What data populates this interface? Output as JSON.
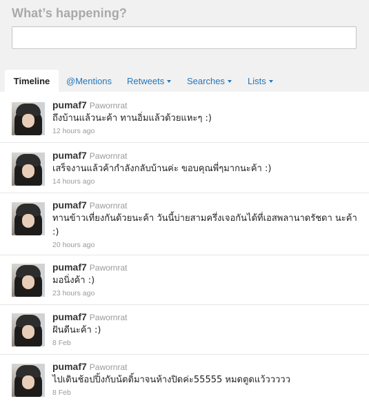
{
  "composer": {
    "heading": "What’s happening?",
    "placeholder": ""
  },
  "tabs": {
    "timeline": "Timeline",
    "mentions": "@Mentions",
    "retweets": "Retweets",
    "searches": "Searches",
    "lists": "Lists"
  },
  "tweets": [
    {
      "screen_name": "pumaf7",
      "full_name": "Pawornrat",
      "text": "ถึงบ้านแล้วนะค้า ทานอิ่มแล้วด้วยแหะๆ :)",
      "time": "12 hours ago"
    },
    {
      "screen_name": "pumaf7",
      "full_name": "Pawornrat",
      "text": "เสร็จงานแล้วค้ากำลังกลับบ้านค่ะ ขอบคุณพี่ๆมากนะค้า :)",
      "time": "14 hours ago"
    },
    {
      "screen_name": "pumaf7",
      "full_name": "Pawornrat",
      "text": "ทานข้าวเที่ยงกันด้วยนะค้า วันนี้บ่ายสามครึ่งเจอกันได้ที่เอสพลานาดรัชดา นะค้า :)",
      "time": "20 hours ago"
    },
    {
      "screen_name": "pumaf7",
      "full_name": "Pawornrat",
      "text": "มอนิ่งค้า :)",
      "time": "23 hours ago"
    },
    {
      "screen_name": "pumaf7",
      "full_name": "Pawornrat",
      "text": "ฝันดีนะค้า :)",
      "time": "8 Feb"
    },
    {
      "screen_name": "pumaf7",
      "full_name": "Pawornrat",
      "text": "ไปเดินช้อปปิ้งกับน้ตติ้มาจนห้างปิดค่ะ55555 หมดตูดแว้ววววว",
      "time": "8 Feb"
    }
  ]
}
